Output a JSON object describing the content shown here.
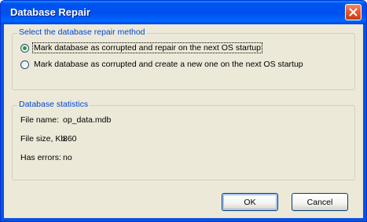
{
  "window": {
    "title": "Database Repair",
    "close_icon": "close-icon",
    "colors": {
      "titlebar": "#0053ee",
      "close_button": "#e3582e",
      "dialog_background": "#ece9d8",
      "group_title": "#0046d5",
      "radio_checked": "#21a121"
    }
  },
  "repair_method": {
    "title": "Select the database repair method",
    "options": [
      {
        "label": "Mark database as corrupted and repair on the next OS startup",
        "selected": true
      },
      {
        "label": "Mark database as corrupted and create a new one on the next OS startup",
        "selected": false
      }
    ]
  },
  "statistics": {
    "title": "Database statistics",
    "rows": [
      {
        "label": "File name:",
        "value": "op_data.mdb"
      },
      {
        "label": "File size, Kb:",
        "value": "860"
      },
      {
        "label": "Has errors:",
        "value": "no"
      }
    ]
  },
  "buttons": {
    "ok": "OK",
    "cancel": "Cancel"
  }
}
